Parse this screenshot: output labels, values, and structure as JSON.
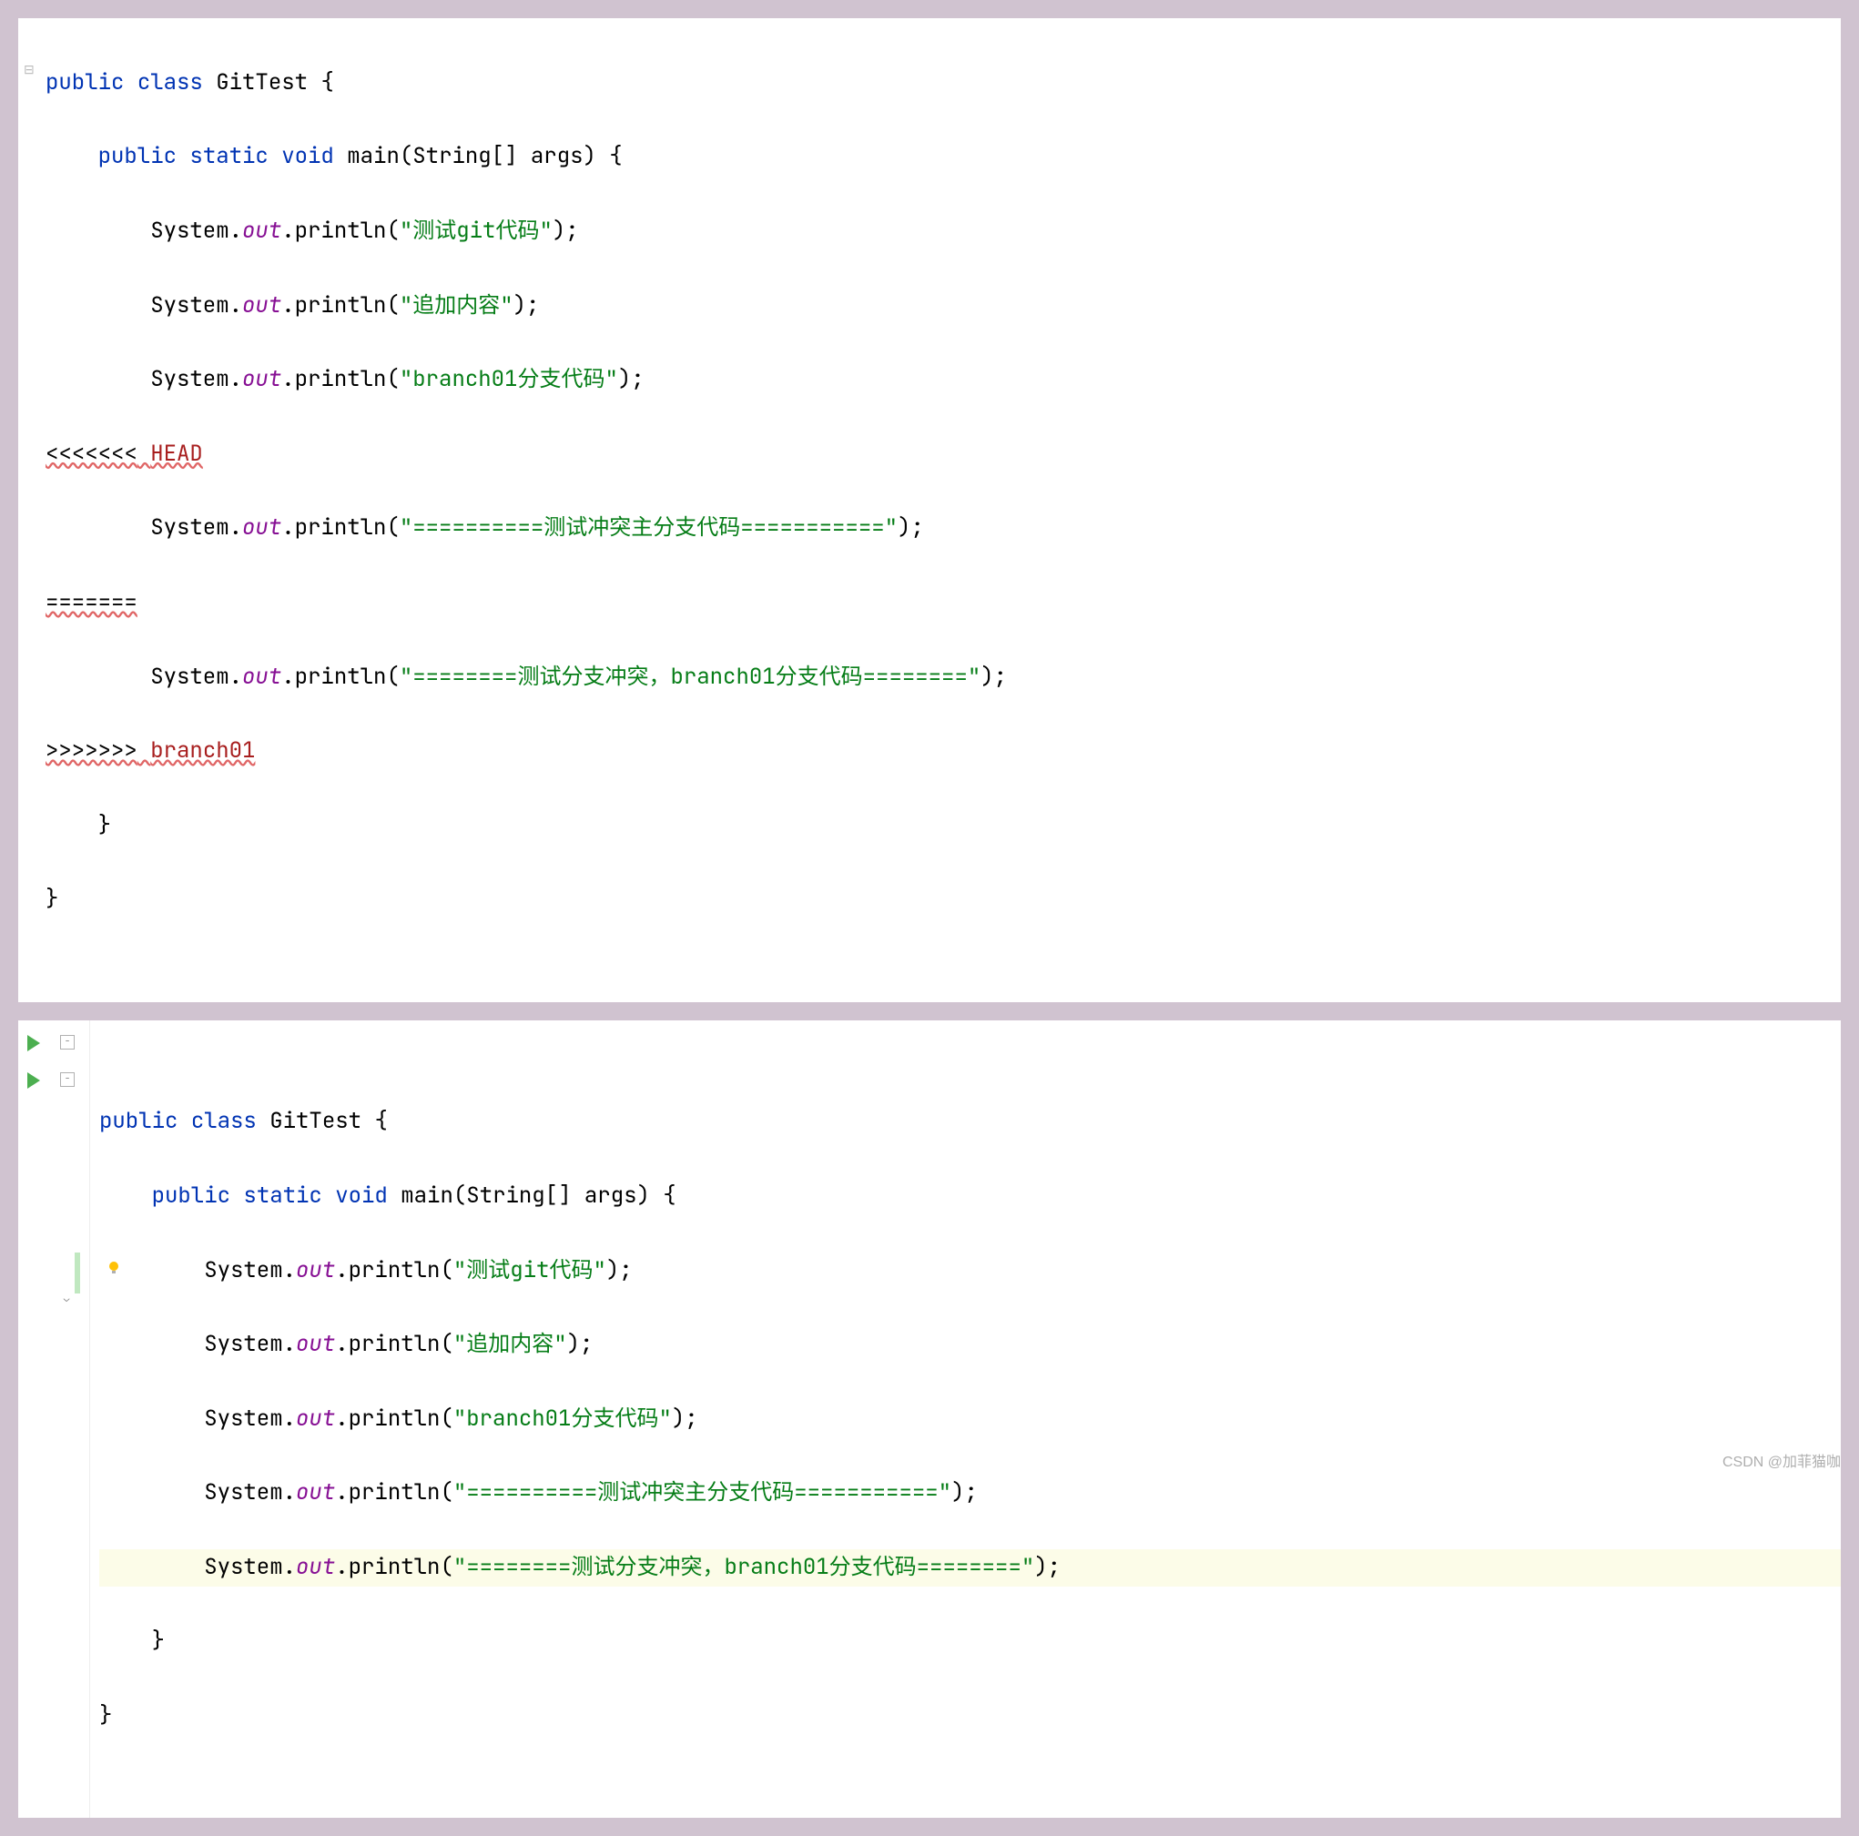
{
  "panel1": {
    "kw_public": "public",
    "kw_class": "class",
    "cls_name": "GitTest",
    "kw_static": "static",
    "kw_void": "void",
    "m_main": "main",
    "p_type": "String",
    "p_name": "args",
    "sys": "System",
    "out": "out",
    "println": "println",
    "str1": "\"测试git代码\"",
    "str2": "\"追加内容\"",
    "str3": "\"branch01分支代码\"",
    "conflict_head_marker": "<<<<<<<",
    "conflict_head_label": "HEAD",
    "str4": "\"==========测试冲突主分支代码===========\"",
    "conflict_sep": "=======",
    "str5": "\"========测试分支冲突，branch01分支代码========\"",
    "conflict_end_marker": ">>>>>>>",
    "conflict_end_label": "branch01"
  },
  "panel2": {
    "kw_public": "public",
    "kw_class": "class",
    "cls_name": "GitTest",
    "kw_static": "static",
    "kw_void": "void",
    "m_main": "main",
    "p_type": "String",
    "p_name": "args",
    "sys": "System",
    "out": "out",
    "println": "println",
    "str1": "\"测试git代码\"",
    "str2": "\"追加内容\"",
    "str3": "\"branch01分支代码\"",
    "str4": "\"==========测试冲突主分支代码===========\"",
    "str5": "\"========测试分支冲突，branch01分支代码========\""
  },
  "watermark": "CSDN @加菲猫咖"
}
